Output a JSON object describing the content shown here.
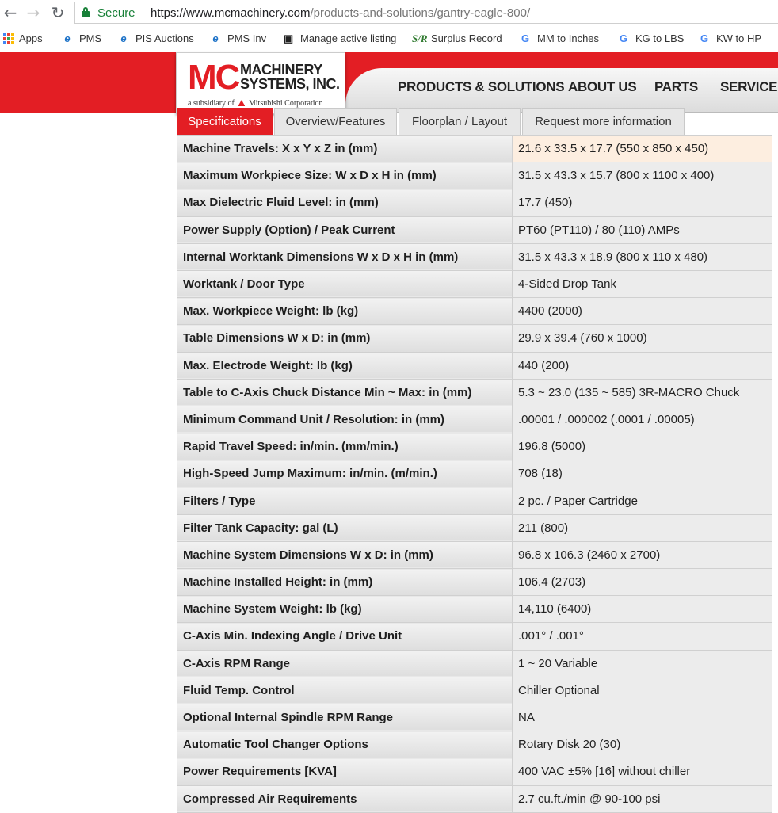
{
  "browser": {
    "secure_label": "Secure",
    "url_host": "https://www.mcmachinery.com",
    "url_path": "/products-and-solutions/gantry-eagle-800/",
    "bookmarks": [
      {
        "label": "Apps"
      },
      {
        "label": "PMS"
      },
      {
        "label": "PIS Auctions"
      },
      {
        "label": "PMS Inv"
      },
      {
        "label": "Manage active listing"
      },
      {
        "label": "Surplus Record"
      },
      {
        "label": "MM to Inches"
      },
      {
        "label": "KG to LBS"
      },
      {
        "label": "KW to HP"
      }
    ]
  },
  "site": {
    "logo_mc": "MC",
    "logo_line1": "MACHINERY",
    "logo_line2": "SYSTEMS, INC.",
    "logo_sub_pre": "a subsidiary of",
    "logo_sub_post": "Mitsubishi Corporation",
    "nav": [
      "PRODUCTS & SOLUTIONS",
      "ABOUT US",
      "PARTS",
      "SERVICE &"
    ]
  },
  "tabs": [
    "Specifications",
    "Overview/Features",
    "Floorplan / Layout",
    "Request more information"
  ],
  "specs": [
    {
      "label": "Machine Travels: X x Y x Z in (mm)",
      "value": "21.6 x 33.5 x 17.7 (550 x 850 x 450)"
    },
    {
      "label": "Maximum Workpiece Size: W x D x H in (mm)",
      "value": "31.5 x 43.3 x 15.7 (800 x 1100 x 400)"
    },
    {
      "label": "Max Dielectric Fluid Level: in (mm)",
      "value": "17.7 (450)"
    },
    {
      "label": "Power Supply (Option) / Peak Current",
      "value": "PT60 (PT110) / 80 (110) AMPs"
    },
    {
      "label": "Internal Worktank Dimensions W x D x H in (mm)",
      "value": "31.5 x 43.3 x 18.9 (800 x 110 x 480)"
    },
    {
      "label": "Worktank / Door Type",
      "value": "4-Sided Drop Tank"
    },
    {
      "label": "Max. Workpiece Weight: lb (kg)",
      "value": "4400 (2000)"
    },
    {
      "label": "Table Dimensions W x D: in (mm)",
      "value": "29.9 x 39.4 (760 x 1000)"
    },
    {
      "label": "Max. Electrode Weight: lb (kg)",
      "value": "440 (200)"
    },
    {
      "label": "Table to C-Axis Chuck Distance Min ~ Max: in (mm)",
      "value": "5.3 ~ 23.0 (135 ~ 585) 3R-MACRO Chuck"
    },
    {
      "label": "Minimum Command Unit / Resolution: in (mm)",
      "value": ".00001 / .000002 (.0001 / .00005)"
    },
    {
      "label": "Rapid Travel Speed: in/min. (mm/min.)",
      "value": "196.8 (5000)"
    },
    {
      "label": "High-Speed Jump Maximum: in/min. (m/min.)",
      "value": "708 (18)"
    },
    {
      "label": "Filters / Type",
      "value": "2 pc. / Paper Cartridge"
    },
    {
      "label": "Filter Tank Capacity: gal (L)",
      "value": "211 (800)"
    },
    {
      "label": "Machine System Dimensions W x D: in (mm)",
      "value": "96.8 x 106.3 (2460 x 2700)"
    },
    {
      "label": "Machine Installed Height: in (mm)",
      "value": "106.4 (2703)"
    },
    {
      "label": "Machine System Weight: lb (kg)",
      "value": "14,110 (6400)"
    },
    {
      "label": "C-Axis Min. Indexing Angle / Drive Unit",
      "value": ".001° / .001°"
    },
    {
      "label": "C-Axis RPM Range",
      "value": "1 ~ 20 Variable"
    },
    {
      "label": "Fluid Temp. Control",
      "value": "Chiller Optional"
    },
    {
      "label": "Optional Internal Spindle RPM Range",
      "value": "NA"
    },
    {
      "label": "Automatic Tool Changer Options",
      "value": "Rotary Disk 20 (30)"
    },
    {
      "label": "Power Requirements [KVA]",
      "value": "400 VAC ±5% [16] without chiller"
    },
    {
      "label": "Compressed Air Requirements",
      "value": "2.7 cu.ft./min @ 90-100 psi"
    }
  ]
}
